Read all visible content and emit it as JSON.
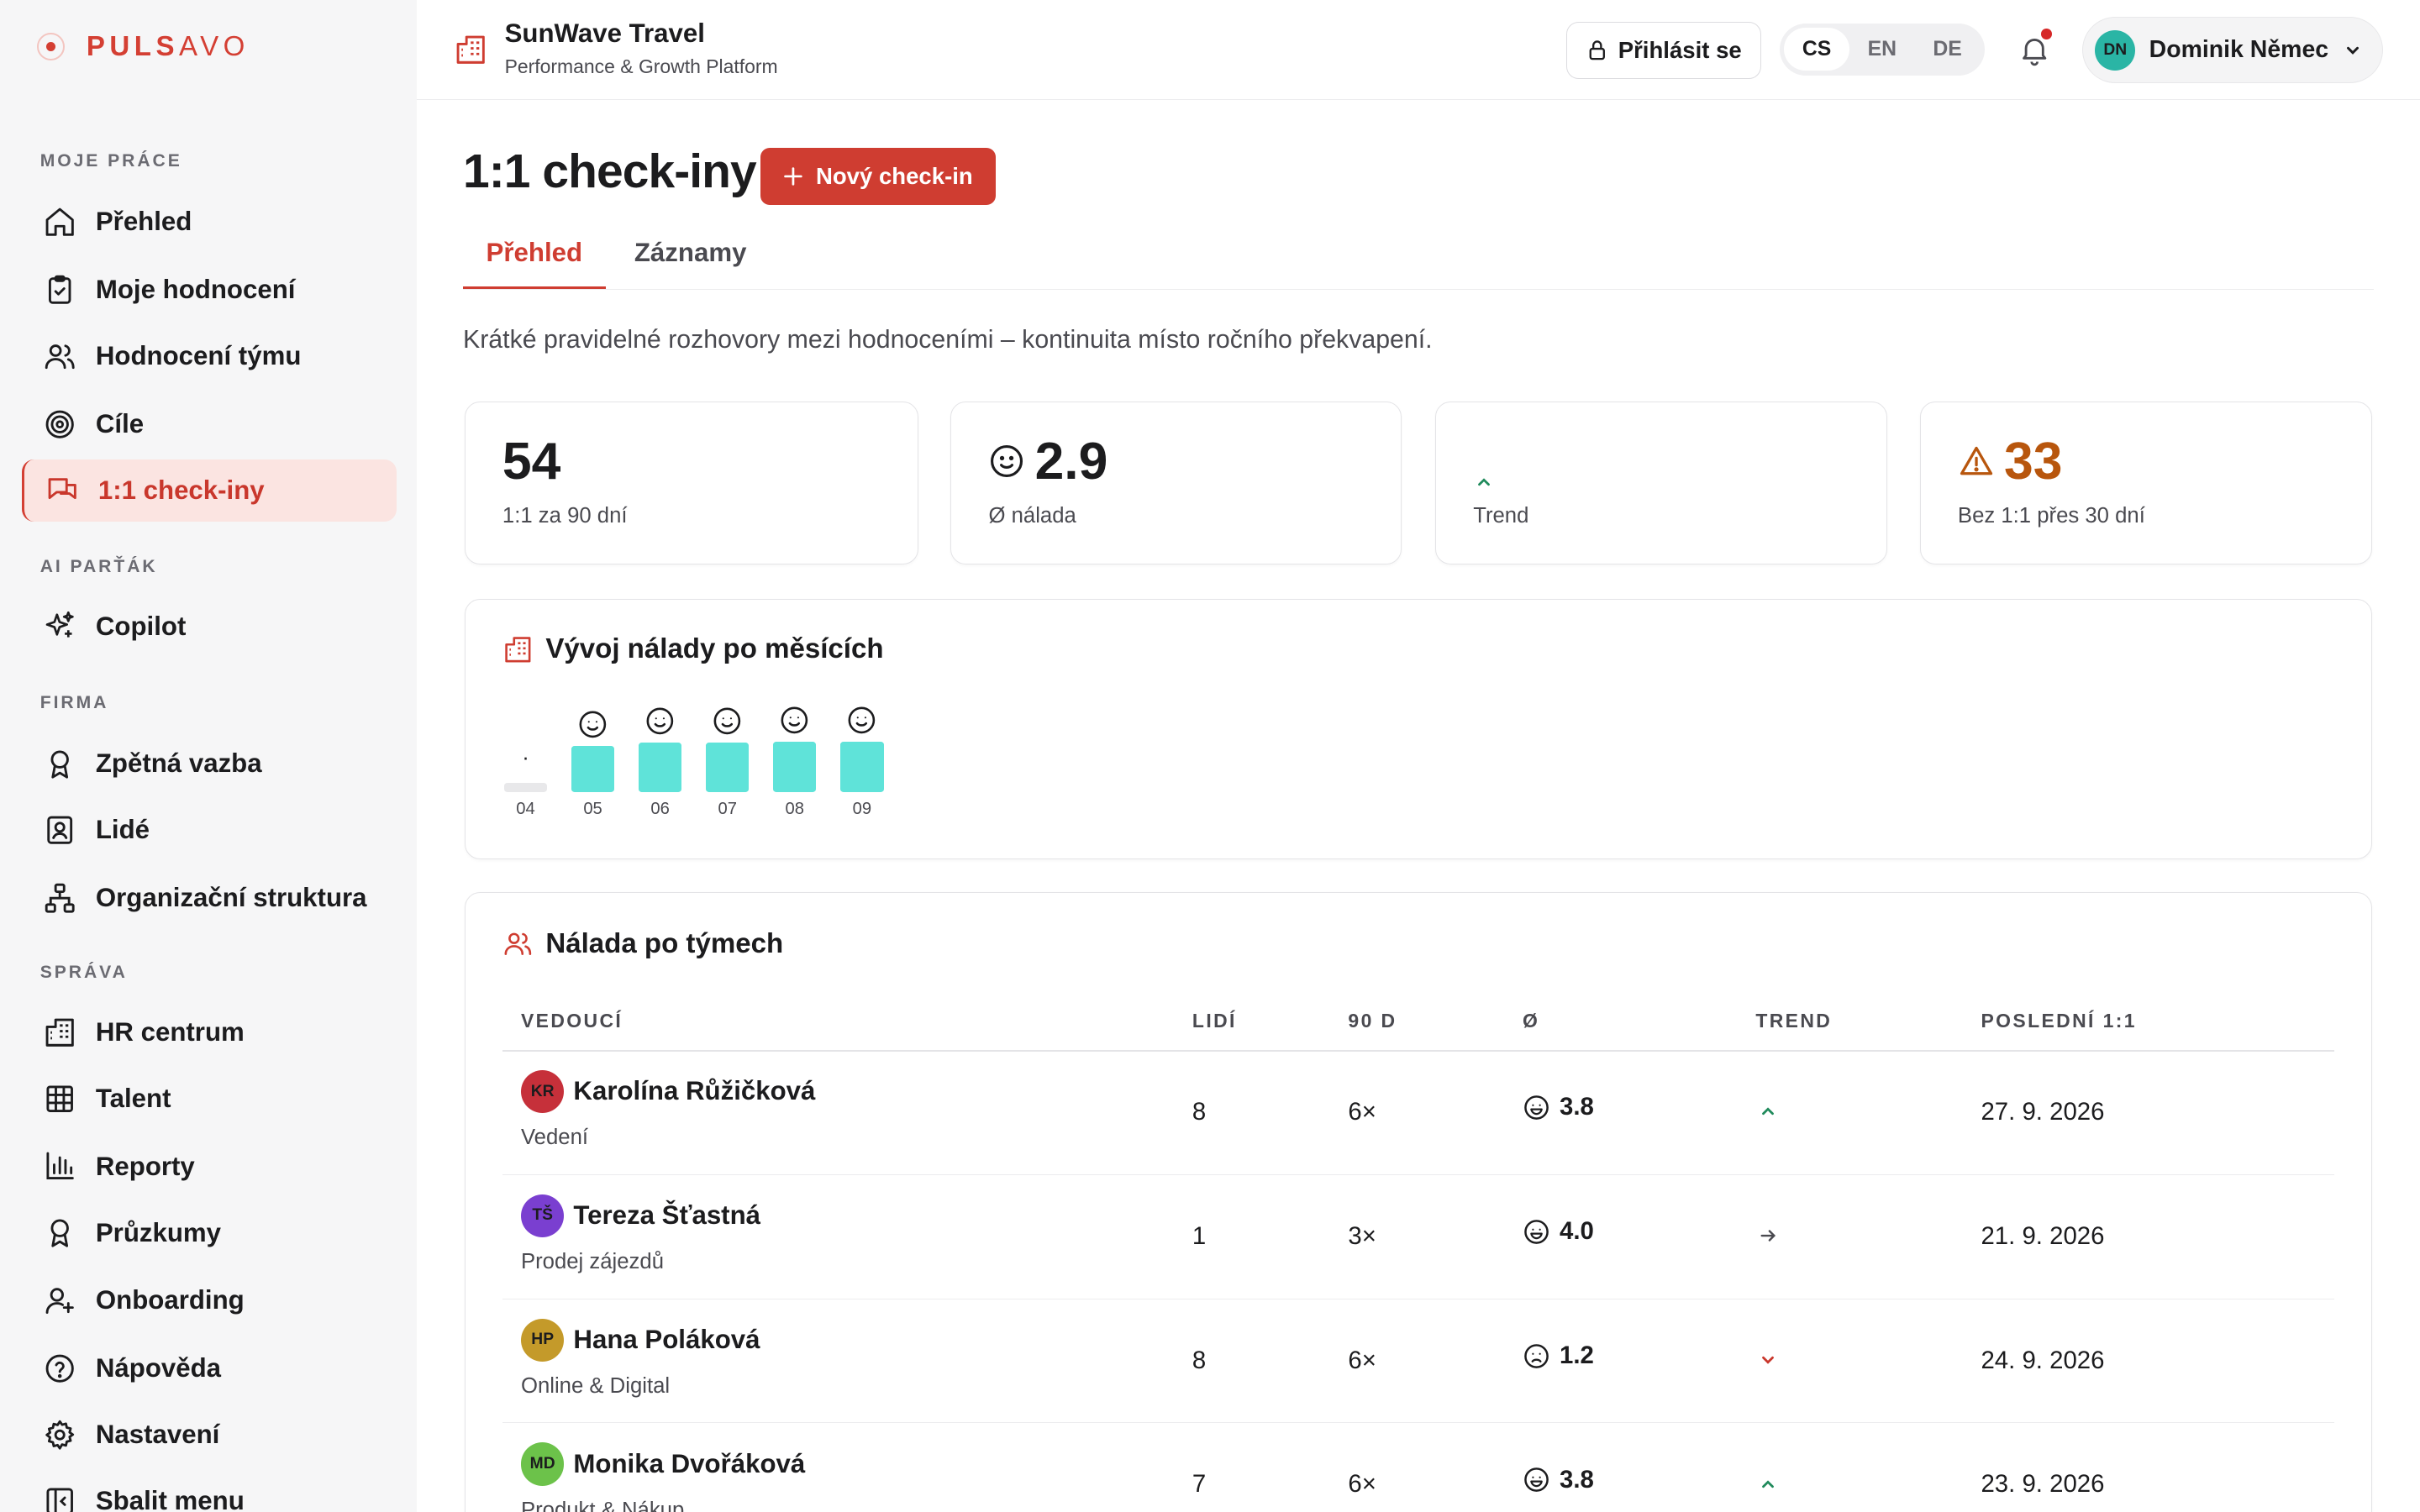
{
  "brand": {
    "name_a": "PULS",
    "name_b": "AVO"
  },
  "company": {
    "name": "SunWave Travel",
    "subtitle": "Performance & Growth Platform"
  },
  "topbar": {
    "login_label": "Přihlásit se",
    "languages": [
      "CS",
      "EN",
      "DE"
    ],
    "active_language": "CS",
    "user_initials": "DN",
    "user_name": "Dominik Němec",
    "user_avatar_color": "#2ab5a5"
  },
  "sidebar": {
    "sections": [
      {
        "title": "MOJE PRÁCE",
        "items": [
          {
            "label": "Přehled",
            "icon": "home-icon"
          },
          {
            "label": "Moje hodnocení",
            "icon": "clipboard-icon"
          },
          {
            "label": "Hodnocení týmu",
            "icon": "users-icon"
          },
          {
            "label": "Cíle",
            "icon": "target-icon"
          },
          {
            "label": "1:1 check-iny",
            "icon": "chat-icon",
            "active": true
          }
        ]
      },
      {
        "title": "AI PARŤÁK",
        "items": [
          {
            "label": "Copilot",
            "icon": "sparkles-icon"
          }
        ]
      },
      {
        "title": "FIRMA",
        "items": [
          {
            "label": "Zpětná vazba",
            "icon": "award-icon"
          },
          {
            "label": "Lidé",
            "icon": "id-card-icon"
          },
          {
            "label": "Organizační struktura",
            "icon": "org-chart-icon"
          }
        ]
      },
      {
        "title": "SPRÁVA",
        "items": [
          {
            "label": "HR centrum",
            "icon": "building-icon"
          },
          {
            "label": "Talent",
            "icon": "grid-icon"
          },
          {
            "label": "Reporty",
            "icon": "bar-chart-icon"
          },
          {
            "label": "Průzkumy",
            "icon": "award-icon"
          },
          {
            "label": "Onboarding",
            "icon": "user-plus-icon"
          },
          {
            "label": "Nápověda",
            "icon": "help-icon"
          },
          {
            "label": "Nastavení",
            "icon": "gear-icon"
          },
          {
            "label": "Sbalit menu",
            "icon": "collapse-icon"
          }
        ]
      }
    ]
  },
  "page": {
    "title": "1:1 check-iny",
    "new_button": "Nový check-in",
    "tabs": [
      "Přehled",
      "Záznamy"
    ],
    "active_tab": "Přehled",
    "lead": "Krátké pravidelné rozhovory mezi hodnoceními – kontinuita místo ročního překvapení."
  },
  "stats": [
    {
      "value": "54",
      "label": "1:1 za 90 dní",
      "icon": ""
    },
    {
      "value": "2.9",
      "label": "Ø nálada",
      "icon": "smile-icon"
    },
    {
      "value": "",
      "label": "Trend",
      "icon": "trend-up-icon"
    },
    {
      "value": "33",
      "label": "Bez 1:1 přes 30 dní",
      "icon": "warning-icon",
      "color": "#b8560d"
    }
  ],
  "mood_chart": {
    "title": "Vývoj nálady po měsících",
    "bar_color": "#5fe3d9",
    "empty_color": "#e8e8ea"
  },
  "chart_data": {
    "type": "bar",
    "categories": [
      "04",
      "05",
      "06",
      "07",
      "08",
      "09"
    ],
    "values": [
      null,
      2.8,
      3.0,
      3.0,
      3.1,
      3.1
    ],
    "empty_marker": [
      "·",
      "",
      "",
      "",
      "",
      ""
    ],
    "title": "Vývoj nálady po měsících",
    "xlabel": "",
    "ylabel": "",
    "ylim": [
      0,
      5
    ],
    "grid": false
  },
  "teams_table": {
    "title": "Nálada po týmech",
    "columns": [
      "VEDOUCÍ",
      "LIDÍ",
      "90 D",
      "Ø",
      "TREND",
      "POSLEDNÍ 1:1"
    ],
    "rows": [
      {
        "initials": "KR",
        "avatar_color": "#c6303a",
        "name": "Karolína Růžičková",
        "team": "Vedení",
        "people": "8",
        "count90": "6×",
        "mood": "3.8",
        "mood_face": "grin",
        "trend": "up",
        "last": "27. 9. 2026"
      },
      {
        "initials": "TŠ",
        "avatar_color": "#7a3fd0",
        "name": "Tereza Šťastná",
        "team": "Prodej zájezdů",
        "people": "1",
        "count90": "3×",
        "mood": "4.0",
        "mood_face": "grin",
        "trend": "flat",
        "last": "21. 9. 2026"
      },
      {
        "initials": "HP",
        "avatar_color": "#c49a2a",
        "name": "Hana Poláková",
        "team": "Online & Digital",
        "people": "8",
        "count90": "6×",
        "mood": "1.2",
        "mood_face": "sad",
        "trend": "down",
        "last": "24. 9. 2026"
      },
      {
        "initials": "MD",
        "avatar_color": "#6cc24a",
        "name": "Monika Dvořáková",
        "team": "Produkt & Nákup",
        "people": "7",
        "count90": "6×",
        "mood": "3.8",
        "mood_face": "grin",
        "trend": "up",
        "last": "23. 9. 2026"
      }
    ]
  }
}
